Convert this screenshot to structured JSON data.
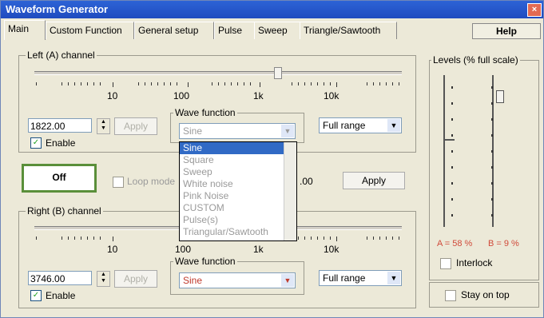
{
  "window": {
    "title": "Waveform Generator",
    "close": "×"
  },
  "tabs": [
    "Main",
    "Custom Function",
    "General setup",
    "Pulse",
    "Sweep",
    "Triangle/Sawtooth"
  ],
  "help_label": "Help",
  "left": {
    "title": "Left (A) channel",
    "scale": [
      "10",
      "100",
      "1k",
      "10k"
    ],
    "frequency": "1822.00",
    "apply": "Apply",
    "enable": "Enable",
    "wave_label": "Wave function",
    "wave_value": "Sine",
    "range_value": "Full range"
  },
  "dropdown": {
    "options": [
      "Sine",
      "Square",
      "Sweep",
      "White noise",
      "Pink Noise",
      "CUSTOM",
      "Pulse(s)",
      "Triangular/Sawtooth"
    ]
  },
  "middle": {
    "off": "Off",
    "loop": "Loop mode",
    "value": ".00",
    "apply": "Apply"
  },
  "right": {
    "title": "Right (B) channel",
    "scale": [
      "10",
      "100",
      "1k",
      "10k"
    ],
    "frequency": "3746.00",
    "apply": "Apply",
    "enable": "Enable",
    "wave_label": "Wave function",
    "wave_value": "Sine",
    "range_value": "Full range"
  },
  "levels": {
    "title": "Levels (% full scale)",
    "a": "A = 58 %",
    "b": "B = 9 %",
    "a_level": 0.58,
    "b_level": 0.09,
    "interlock": "Interlock",
    "stay_on_top": "Stay on top"
  }
}
